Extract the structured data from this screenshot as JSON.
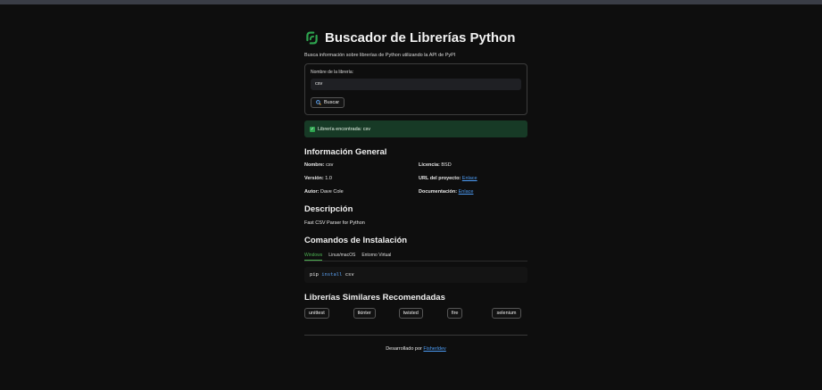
{
  "header": {
    "title": "Buscador de Librerías Python",
    "subtitle": "Busca información sobre librerías de Python utilizando la API de PyPI",
    "accent_color": "#2ea44f"
  },
  "search": {
    "label": "Nombre de la librería:",
    "value": "csv",
    "button_label": "Buscar",
    "button_icon": "search-icon"
  },
  "status": {
    "message": "Librería encontrada: csv",
    "icon": "check-icon",
    "bg_color": "#173a26"
  },
  "general": {
    "heading": "Información General",
    "name_label": "Nombre:",
    "name_value": "csv",
    "license_label": "Licencia:",
    "license_value": "BSD",
    "version_label": "Versión:",
    "version_value": "1.0",
    "url_label": "URL del proyecto:",
    "url_link": "Enlace",
    "author_label": "Autor:",
    "author_value": "Dave Cole",
    "docs_label": "Documentación:",
    "docs_link": "Enlace"
  },
  "description": {
    "heading": "Descripción",
    "text": "Fast CSV Parser for Python"
  },
  "install": {
    "heading": "Comandos de Instalación",
    "tabs": [
      "Windows",
      "Linux/macOS",
      "Entorno Virtual"
    ],
    "active_tab": 0,
    "cmd_pip": "pip",
    "cmd_install": "install",
    "cmd_pkg": "csv"
  },
  "similar": {
    "heading": "Librerías Similares Recomendadas",
    "items": [
      "unittest",
      "tkinter",
      "twisted",
      "fire",
      "selenium"
    ]
  },
  "footer": {
    "prefix": "Desarrollado por",
    "link": "Fisherldev"
  }
}
